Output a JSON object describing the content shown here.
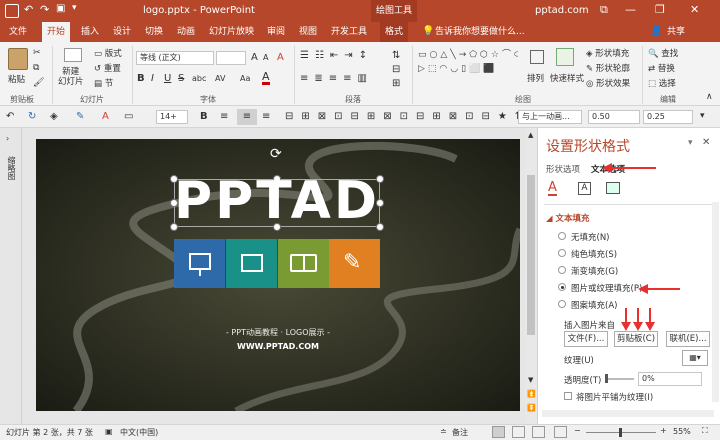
{
  "titlebar": {
    "filename": "logo.pptx",
    "separator": "-",
    "app": "PowerPoint",
    "context_group": "绘图工具",
    "account": "pptad.com",
    "minimize": "—",
    "restore": "❐",
    "close": "✕",
    "ribbon_display": "⧉"
  },
  "tabs": {
    "file": "文件",
    "home": "开始",
    "insert": "插入",
    "design": "设计",
    "transitions": "切换",
    "animations": "动画",
    "slideshow": "幻灯片放映",
    "review": "审阅",
    "view": "视图",
    "developer": "开发工具",
    "format": "格式",
    "tellme": "告诉我你想要做什么...",
    "share": "共享"
  },
  "ribbon": {
    "clipboard": {
      "paste": "粘贴",
      "group": "剪贴板"
    },
    "slides": {
      "new_slide": "新建\n幻灯片",
      "layout": "版式",
      "reset": "重置",
      "section": "节",
      "group": "幻灯片"
    },
    "font": {
      "name": "等线 (正文)",
      "size": "",
      "bold": "B",
      "italic": "I",
      "underline": "U",
      "strike": "S",
      "shadow": "abc",
      "spacing": "AV",
      "case": "Aa",
      "grow": "A",
      "shrink": "A",
      "clear": "A",
      "color": "A",
      "group": "字体"
    },
    "paragraph": {
      "group": "段落"
    },
    "drawing": {
      "arrange": "排列",
      "quick_styles": "快速样式",
      "fill": "形状填充",
      "outline": "形状轮廓",
      "effects": "形状效果",
      "group": "绘图"
    },
    "editing": {
      "find": "查找",
      "replace": "替换",
      "select": "选择",
      "group": "编辑"
    }
  },
  "qat": {
    "font_size": "14+",
    "selection_text": "与上一动画...",
    "width_value": "0.50",
    "height_value": "0.25"
  },
  "thumbnails_label": "缩略图",
  "slide": {
    "title": "PPTAD",
    "subtitle": "- PPT动画教程 · LOGO展示 -",
    "url": "WWW.PPTAD.COM",
    "colors": {
      "tile1": "#2e6aaa",
      "tile2": "#1a9188",
      "tile3": "#7a9a32",
      "tile4": "#e08020"
    }
  },
  "pane": {
    "title": "设置形状格式",
    "tab_shape": "形状选项",
    "tab_text": "文本选项",
    "section": "文本填充",
    "options": [
      "无填充(N)",
      "纯色填充(S)",
      "渐变填充(G)",
      "图片或纹理填充(P)",
      "图案填充(A)"
    ],
    "selected_index": 3,
    "insert_from": "插入图片来自",
    "file_btn": "文件(F)...",
    "clipboard_btn": "剪贴板(C)",
    "online_btn": "联机(E)...",
    "texture": "纹理(U)",
    "transparency": "透明度(T)",
    "transparency_value": "0%",
    "tile_label": "将图片平铺为纹理(I)"
  },
  "status": {
    "slide_info": "幻灯片 第 2 张，共 7 张",
    "language": "中文(中国)",
    "notes": "备注",
    "zoom": "55%"
  },
  "colors": {
    "accent": "#b7472a",
    "annotation_red": "#e8302f"
  }
}
